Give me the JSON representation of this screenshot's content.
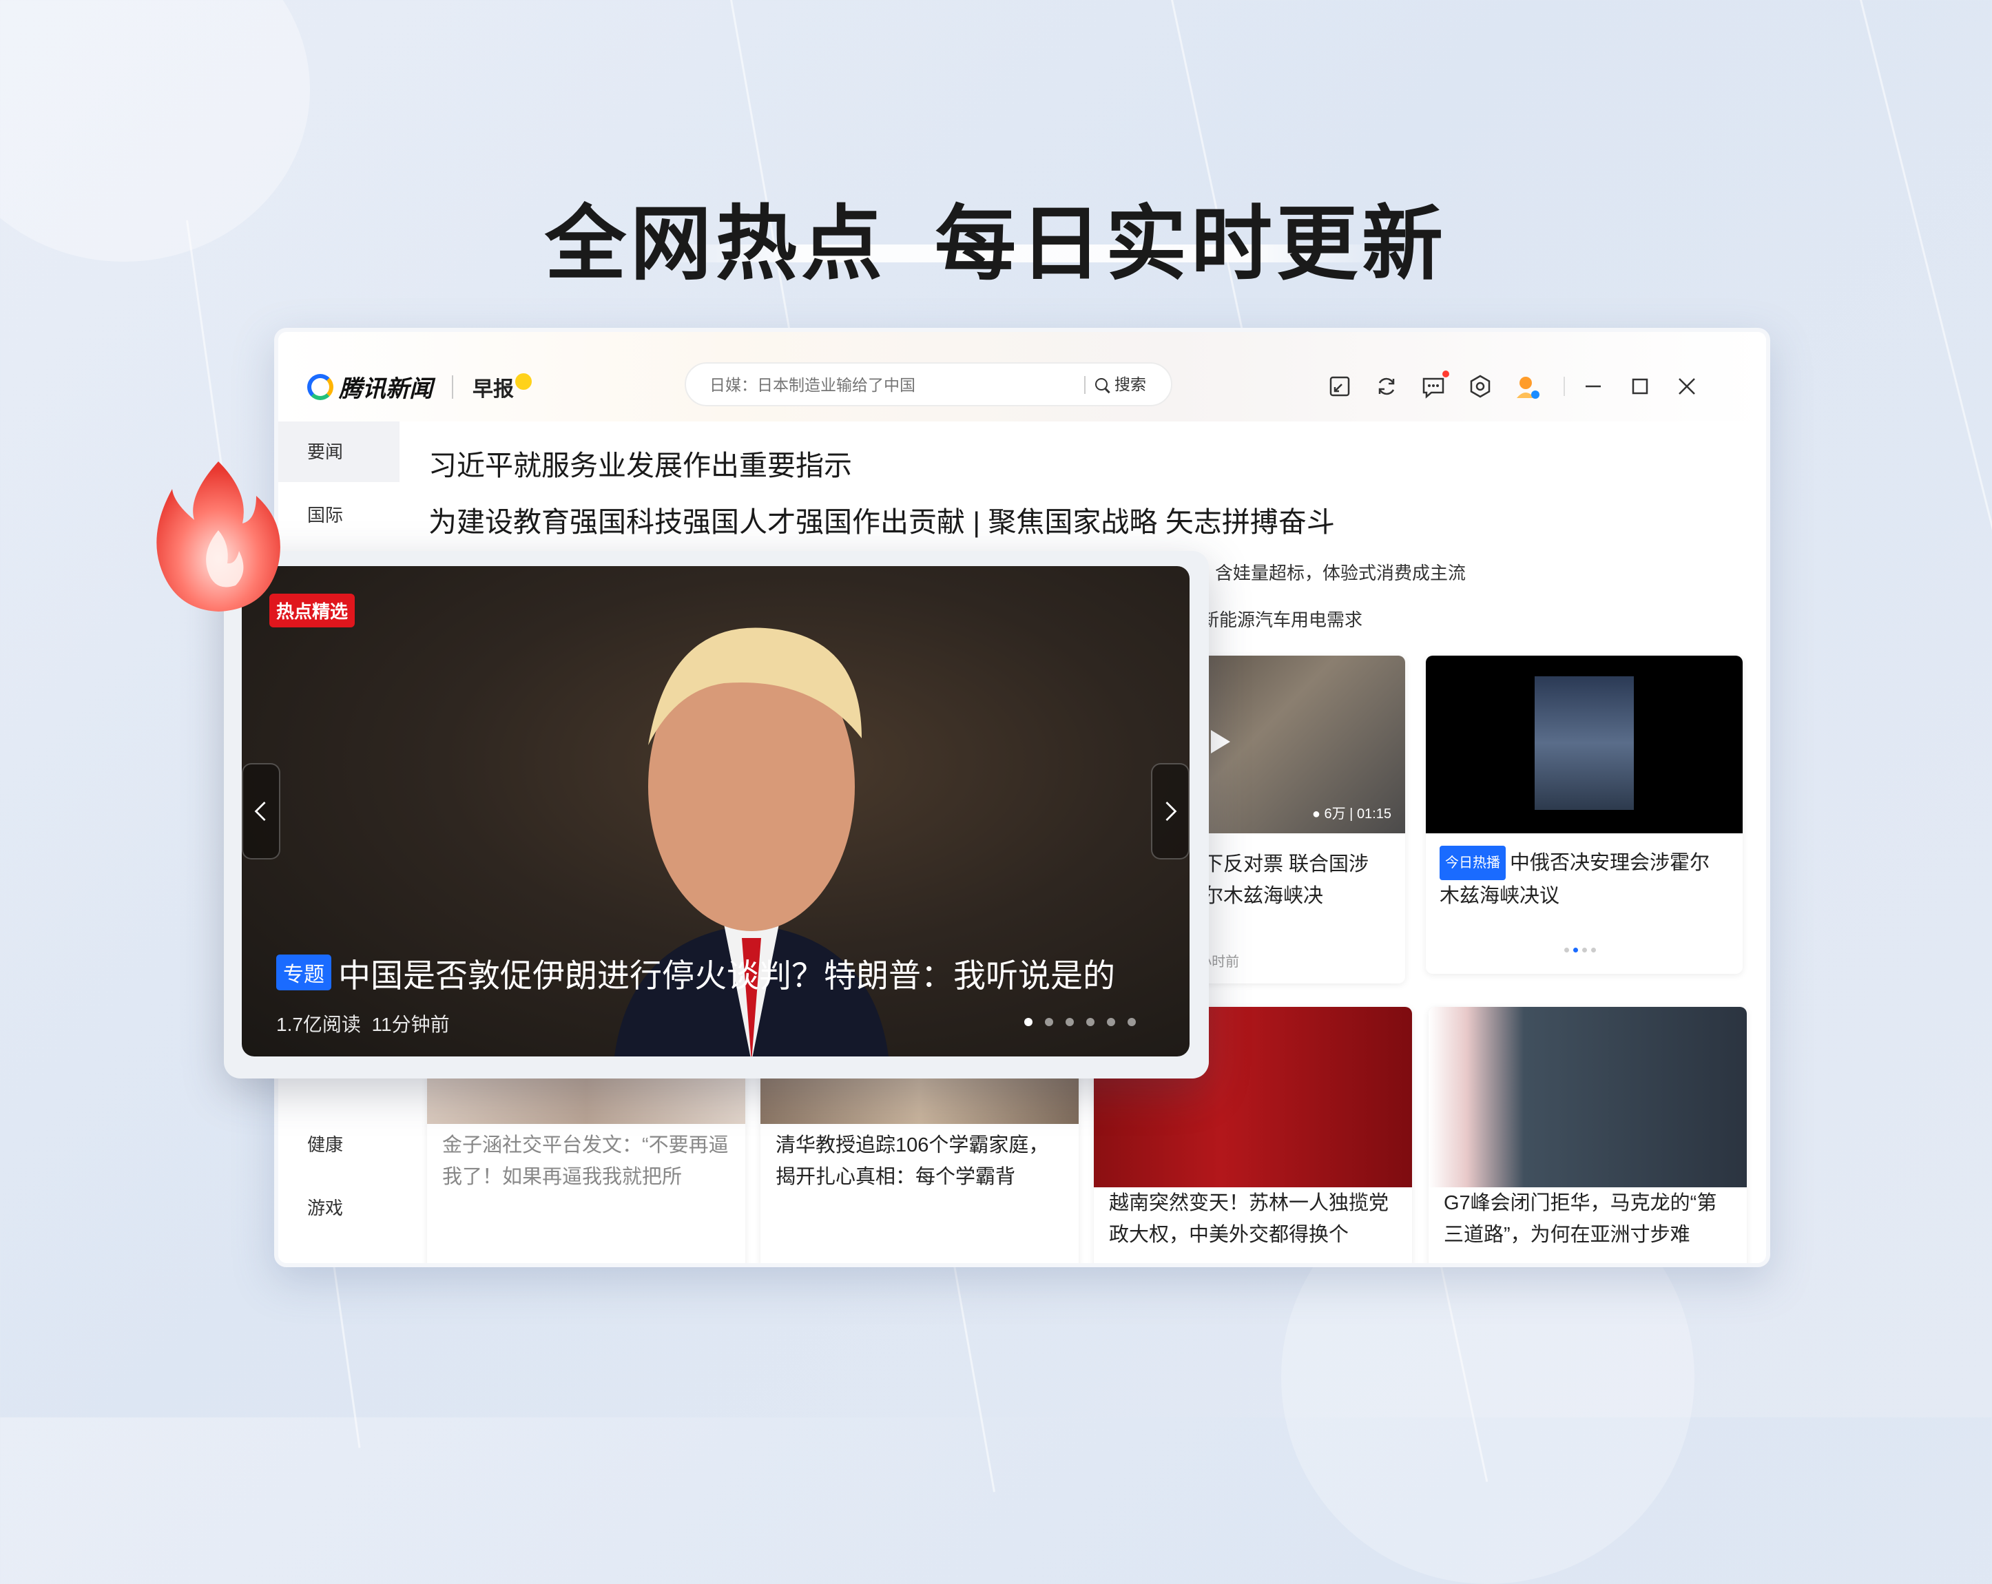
{
  "hero": {
    "title_a": "全网热点",
    "title_b": "每日实时更新"
  },
  "app": {
    "logo_text": "腾讯新闻",
    "morning_label": "早报",
    "search": {
      "placeholder": "日媒：日本制造业输给了中国",
      "button": "搜索"
    },
    "toolbar_icons": [
      "restore-window-icon",
      "refresh-icon",
      "message-icon",
      "settings-icon",
      "avatar-icon"
    ]
  },
  "sidebar": {
    "items": [
      {
        "label": "要闻"
      },
      {
        "label": "国际"
      },
      {
        "label": "健康"
      },
      {
        "label": "游戏"
      }
    ]
  },
  "headlines": [
    "习近平就服务业发展作出重要指示",
    "为建设教育强国科技强国人才强国作出贡献 | 聚焦国家战略 矢志拼搏奋斗"
  ],
  "sub_news": [
    "含娃量超标，体验式消费成主流",
    "新能源汽车用电需求"
  ],
  "video_card": {
    "views": "6万",
    "duration": "01:15",
    "title": "投下反对票 联合国涉霍尔木兹海峡决",
    "time": "7小时前"
  },
  "hot_card": {
    "badge": "今日热播",
    "title": "中俄否决安理会涉霍尔木兹海峡决议"
  },
  "bottom_cards": [
    {
      "title": "金子涵社交平台发文：“不要再逼我了！如果再逼我我就把所"
    },
    {
      "title": "清华教授追踪106个学霸家庭，揭开扎心真相：每个学霸背"
    },
    {
      "title": "越南突然变天！苏林一人独揽党政大权，中美外交都得换个"
    },
    {
      "title": "G7峰会闭门拒华，马克龙的“第三道路”，为何在亚洲寸步难"
    }
  ],
  "featured": {
    "tag": "热点精选",
    "special": "专题",
    "title": "中国是否敦促伊朗进行停火谈判？特朗普：我听说是的",
    "reads": "1.7亿阅读",
    "time": "11分钟前",
    "slide_count": 6,
    "active_slide": 1
  },
  "colors": {
    "accent": "#1a6bff",
    "hot_red": "#e0161d"
  }
}
